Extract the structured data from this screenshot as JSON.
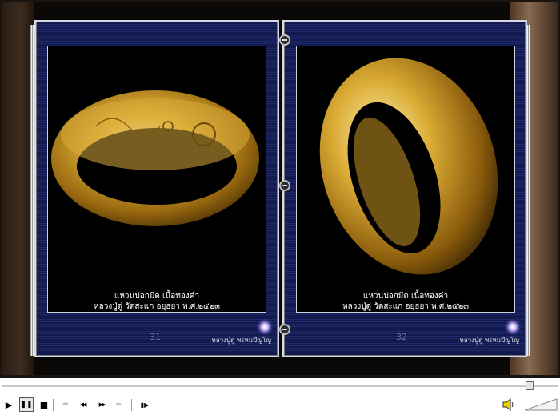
{
  "left_page": {
    "caption_line1": "แหวนปอกมีด เนื้อทองคำ",
    "caption_line2": "หลวงปู่ดู่ วัดสะแก อยุธยา พ.ศ.๒๕๒๓",
    "page_number": "31",
    "brand": "หลวงปู่ดู่ พรหมปัญโญ"
  },
  "right_page": {
    "caption_line1": "แหวนปอกมีด เนื้อทองคำ",
    "caption_line2": "หลวงปู่ดู่ วัดสะแก อยุธยา พ.ศ.๒๕๒๓",
    "page_number": "32",
    "brand": "หลวงปู่ดู่ พรหมปัญโญ"
  },
  "player": {
    "seek_fraction": 0.955,
    "buttons": [
      {
        "icon": "play-icon",
        "glyph": "▶",
        "enabled": true
      },
      {
        "icon": "pause-icon",
        "glyph": "❚❚",
        "enabled": true,
        "pressed": true
      },
      {
        "icon": "stop-icon",
        "glyph": "■",
        "enabled": true
      },
      {
        "icon": "previous-track-icon",
        "glyph": "⏮",
        "enabled": false
      },
      {
        "icon": "rewind-icon",
        "glyph": "◀◀",
        "enabled": true
      },
      {
        "icon": "fast-forward-icon",
        "glyph": "▶▶",
        "enabled": true
      },
      {
        "icon": "next-track-icon",
        "glyph": "⏭",
        "enabled": false
      },
      {
        "icon": "frame-step-icon",
        "glyph": "▮▶",
        "enabled": true
      }
    ],
    "volume_icon": "speaker-icon",
    "colors": {
      "page_blue": "#121a52",
      "gold": "#c9a227"
    }
  }
}
